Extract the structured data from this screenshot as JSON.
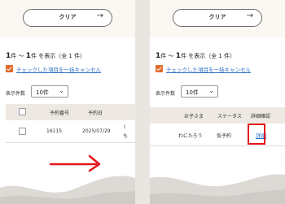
{
  "left": {
    "clear_label": "クリア",
    "count_prefix": "1",
    "count_mid": "件 ～ ",
    "count_second": "1",
    "count_suffix": "件 を表示（全 1 件）",
    "cancel_text": "チェックした項目を一括キャンセル",
    "display_label": "表示件数",
    "select_value": "10件",
    "table": {
      "headers": [
        "予約番号",
        "予約日"
      ],
      "row": {
        "id": "16115",
        "date": "2025/07/29",
        "overflow": "(",
        "overflow2": "も"
      }
    }
  },
  "right": {
    "clear_label": "クリア",
    "count_prefix": "1",
    "count_mid": "件 ～ ",
    "count_second": "1",
    "count_suffix": "件 を表示（全 1 件）",
    "cancel_text": "チェックした項目を一括キャンセル",
    "display_label": "表示件数",
    "select_value": "10件",
    "table": {
      "headers": [
        "お子さま",
        "ステータス",
        "詳細確認"
      ],
      "row": {
        "child": "わにたろう",
        "status": "仮予約",
        "detail": "詳細"
      }
    }
  },
  "colors": {
    "accent": "#e06a2b",
    "link": "#2a6fc7",
    "highlight": "#e3141b",
    "arrow": "#e3141b"
  },
  "icons": {
    "arrow": "arrow-right-icon",
    "chevron": "chevron-down-icon",
    "check": "check-icon"
  }
}
